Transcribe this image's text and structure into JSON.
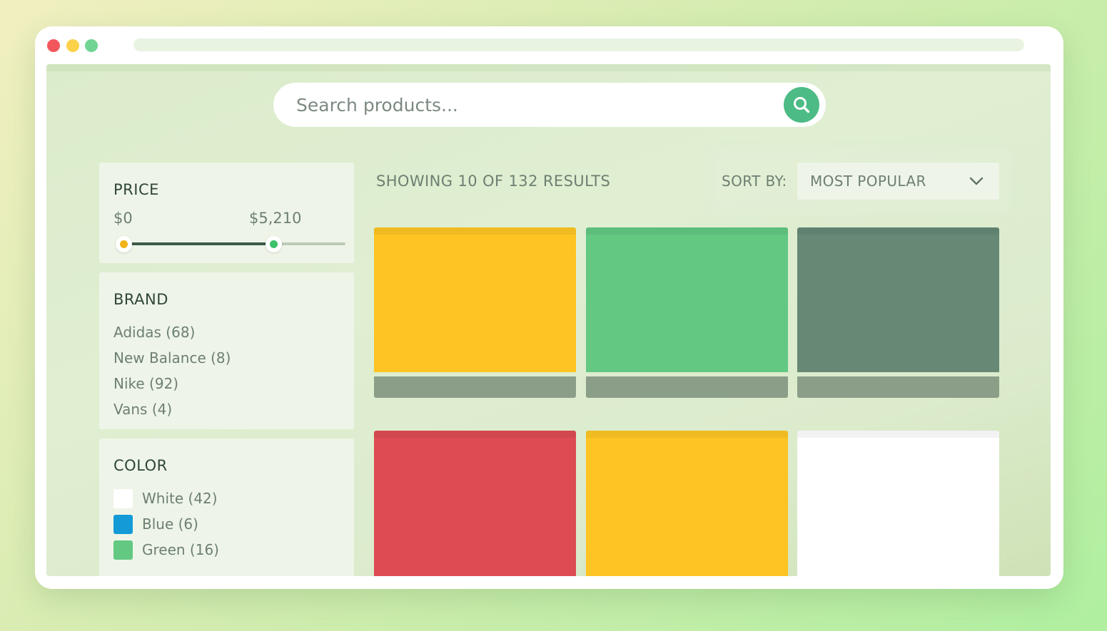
{
  "colors": {
    "yellow": "#fdc423",
    "green": "#63c882",
    "dark_green": "#668875",
    "red": "#de4b52",
    "white": "#ffffff",
    "blue": "#139ad7",
    "accent": "#4dbb86"
  },
  "search": {
    "placeholder": "Search products...",
    "value": "",
    "icon": "search-icon"
  },
  "filters": {
    "price": {
      "title": "PRICE",
      "min_label": "$0",
      "max_label": "$5,210",
      "range_fraction": [
        0.0,
        0.68
      ]
    },
    "brand": {
      "title": "BRAND",
      "items": [
        {
          "label": "Adidas (68)"
        },
        {
          "label": "New Balance (8)"
        },
        {
          "label": "Nike (92)"
        },
        {
          "label": "Vans (4)"
        }
      ]
    },
    "color": {
      "title": "COLOR",
      "items": [
        {
          "label": "White (42)",
          "swatch": "#ffffff"
        },
        {
          "label": "Blue (6)",
          "swatch": "#139ad7"
        },
        {
          "label": "Green (16)",
          "swatch": "#63c882"
        }
      ]
    }
  },
  "results": {
    "count_text": "SHOWING 10 OF 132 RESULTS",
    "sort_label": "SORT BY:",
    "sort_value": "MOST POPULAR",
    "sort_icon": "chevron-down-icon"
  },
  "products": [
    {
      "color": "#fdc423"
    },
    {
      "color": "#63c882"
    },
    {
      "color": "#668875"
    },
    {
      "color": "#de4b52"
    },
    {
      "color": "#fdc423"
    },
    {
      "color": "#ffffff"
    }
  ]
}
